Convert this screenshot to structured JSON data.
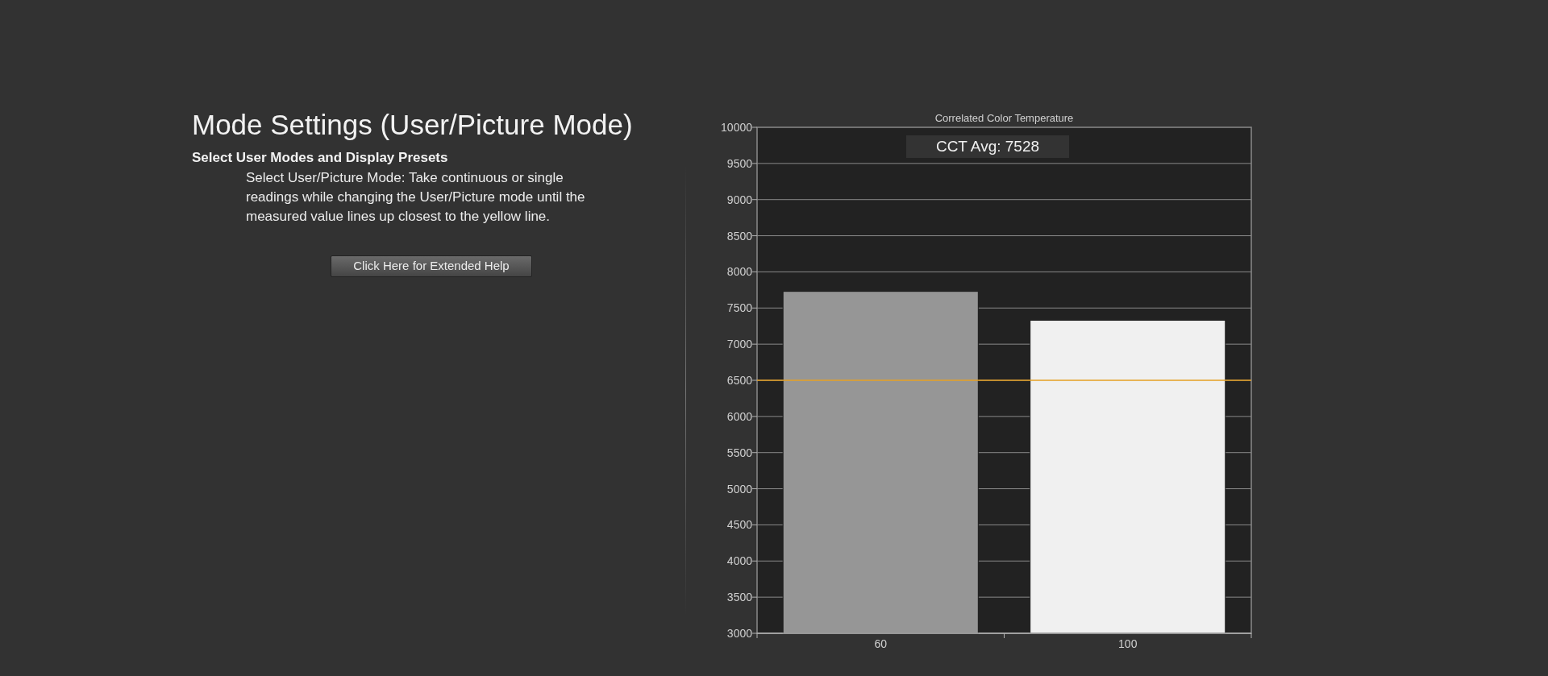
{
  "heading": "Mode Settings (User/Picture Mode)",
  "subheading": "Select User Modes and Display Presets",
  "instructions": "Select User/Picture Mode: Take continuous or single readings while changing the User/Picture mode until the measured value lines up closest to the yellow line.",
  "help_button": "Click Here for Extended Help",
  "chart": {
    "chart_data": {
      "type": "bar",
      "title": "Correlated Color Temperature",
      "categories": [
        "60",
        "100"
      ],
      "series": [
        {
          "color": "#969696",
          "values": [
            7730,
            null
          ]
        },
        {
          "color": "#f0f0f0",
          "values": [
            null,
            7330
          ]
        }
      ],
      "grid": true,
      "ref_lines": [
        {
          "axis": "y",
          "value": 6500,
          "color": "#e6a023"
        }
      ],
      "ylim": [
        3000,
        10000
      ],
      "yticks": [
        3000,
        3500,
        4000,
        4500,
        5000,
        5500,
        6000,
        6500,
        7000,
        7500,
        8000,
        8500,
        9000,
        9500,
        10000
      ],
      "annotations": [
        {
          "text": "CCT Avg: 7528"
        }
      ]
    }
  }
}
